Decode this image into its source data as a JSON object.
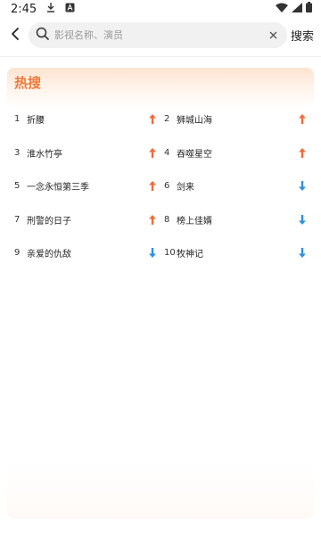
{
  "status_bar": {
    "time": "2:45",
    "icons": [
      "download-icon",
      "app-a-icon",
      "wifi-icon",
      "signal-icon",
      "battery-icon"
    ]
  },
  "search": {
    "back_icon": "chevron-left-icon",
    "search_icon": "search-icon",
    "placeholder": "影视名称、演员",
    "value": "",
    "clear_icon": "close-icon",
    "action_label": "搜索"
  },
  "hot": {
    "title": "热搜",
    "items": [
      {
        "rank": "1",
        "name": "折腰",
        "trend": "up"
      },
      {
        "rank": "2",
        "name": "狮城山海",
        "trend": "up"
      },
      {
        "rank": "3",
        "name": "淮水竹亭",
        "trend": "up"
      },
      {
        "rank": "4",
        "name": "吞噬星空",
        "trend": "up"
      },
      {
        "rank": "5",
        "name": "一念永恒第三季",
        "trend": "up"
      },
      {
        "rank": "6",
        "name": "剑来",
        "trend": "down"
      },
      {
        "rank": "7",
        "name": "刑警的日子",
        "trend": "up"
      },
      {
        "rank": "8",
        "name": "榜上佳婿",
        "trend": "down"
      },
      {
        "rank": "9",
        "name": "亲爱的仇敌",
        "trend": "down"
      },
      {
        "rank": "10",
        "name": "牧神记",
        "trend": "down"
      }
    ]
  },
  "colors": {
    "accent": "#f07a3c",
    "up": "#f26b3a",
    "down": "#2f8fe0"
  }
}
